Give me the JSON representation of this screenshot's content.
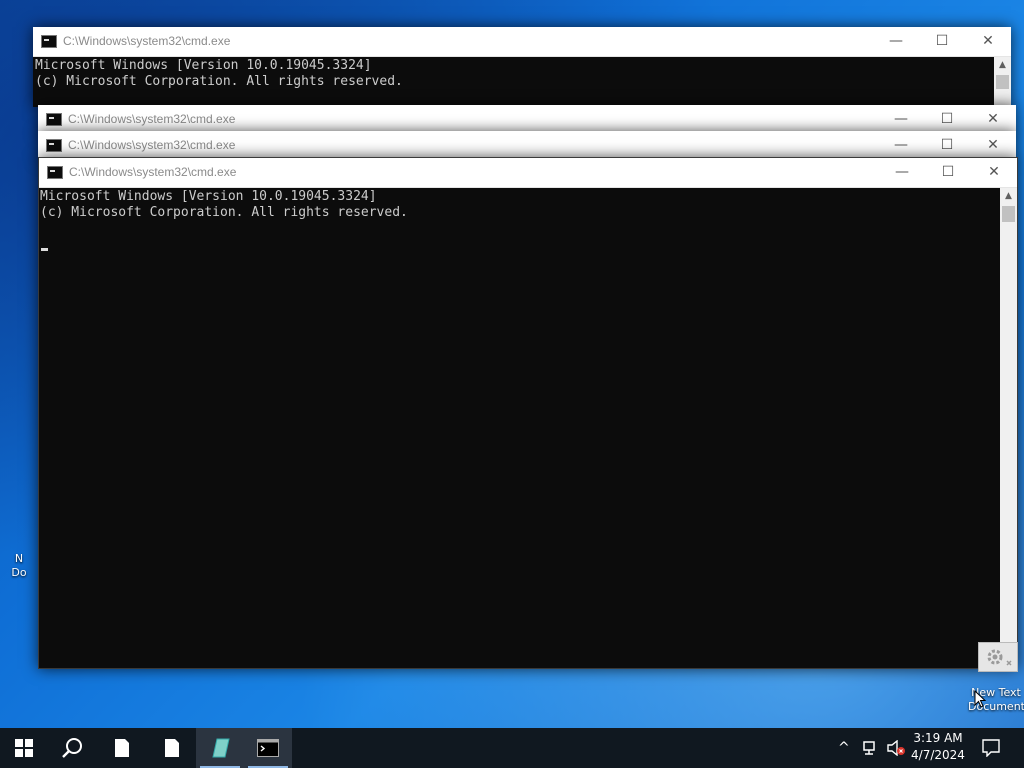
{
  "desktop": {
    "icons": [
      {
        "label_line1": "New Text",
        "label_line2": "Document"
      },
      {
        "label_line1": "N",
        "label_line2": "Do"
      }
    ]
  },
  "windows": [
    {
      "title": "C:\\Windows\\system32\\cmd.exe",
      "lines": [
        "Microsoft Windows [Version 10.0.19045.3324]",
        "(c) Microsoft Corporation. All rights reserved."
      ]
    },
    {
      "title": "C:\\Windows\\system32\\cmd.exe"
    },
    {
      "title": "C:\\Windows\\system32\\cmd.exe"
    },
    {
      "title": "C:\\Windows\\system32\\cmd.exe",
      "lines": [
        "Microsoft Windows [Version 10.0.19045.3324]",
        "(c) Microsoft Corporation. All rights reserved."
      ]
    }
  ],
  "window_controls": {
    "minimize": "—",
    "maximize": "☐",
    "close": "✕"
  },
  "taskbar": {
    "clock_time": "3:19 AM",
    "clock_date": "4/7/2024",
    "icons": [
      "windows-logo-icon",
      "search-icon",
      "file-icon",
      "file-icon",
      "paint-icon",
      "cmd-icon"
    ]
  }
}
